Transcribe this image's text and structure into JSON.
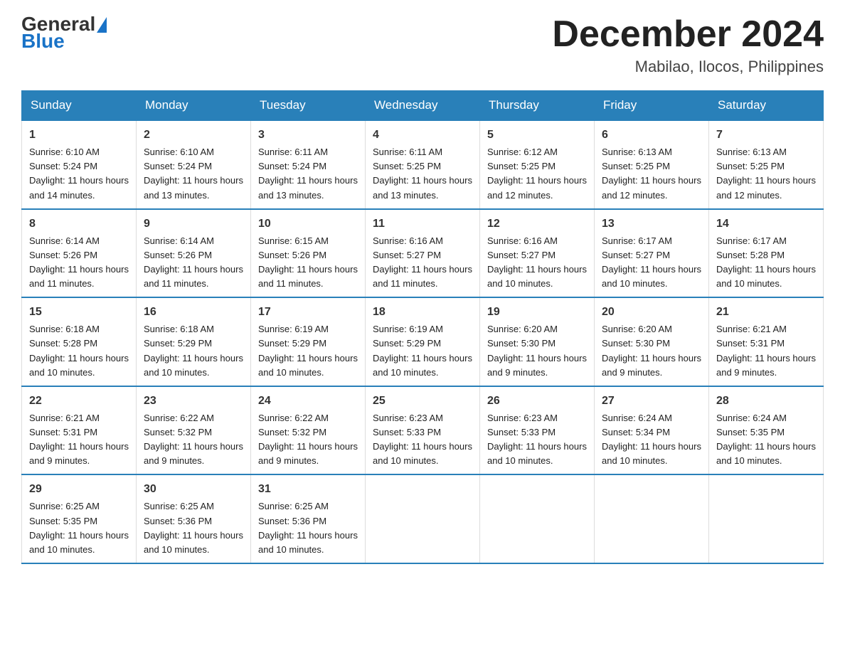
{
  "header": {
    "logo_general": "General",
    "logo_blue": "Blue",
    "month_title": "December 2024",
    "location": "Mabilao, Ilocos, Philippines"
  },
  "days_of_week": [
    "Sunday",
    "Monday",
    "Tuesday",
    "Wednesday",
    "Thursday",
    "Friday",
    "Saturday"
  ],
  "weeks": [
    [
      {
        "day": "1",
        "sunrise": "6:10 AM",
        "sunset": "5:24 PM",
        "daylight": "11 hours and 14 minutes."
      },
      {
        "day": "2",
        "sunrise": "6:10 AM",
        "sunset": "5:24 PM",
        "daylight": "11 hours and 13 minutes."
      },
      {
        "day": "3",
        "sunrise": "6:11 AM",
        "sunset": "5:24 PM",
        "daylight": "11 hours and 13 minutes."
      },
      {
        "day": "4",
        "sunrise": "6:11 AM",
        "sunset": "5:25 PM",
        "daylight": "11 hours and 13 minutes."
      },
      {
        "day": "5",
        "sunrise": "6:12 AM",
        "sunset": "5:25 PM",
        "daylight": "11 hours and 12 minutes."
      },
      {
        "day": "6",
        "sunrise": "6:13 AM",
        "sunset": "5:25 PM",
        "daylight": "11 hours and 12 minutes."
      },
      {
        "day": "7",
        "sunrise": "6:13 AM",
        "sunset": "5:25 PM",
        "daylight": "11 hours and 12 minutes."
      }
    ],
    [
      {
        "day": "8",
        "sunrise": "6:14 AM",
        "sunset": "5:26 PM",
        "daylight": "11 hours and 11 minutes."
      },
      {
        "day": "9",
        "sunrise": "6:14 AM",
        "sunset": "5:26 PM",
        "daylight": "11 hours and 11 minutes."
      },
      {
        "day": "10",
        "sunrise": "6:15 AM",
        "sunset": "5:26 PM",
        "daylight": "11 hours and 11 minutes."
      },
      {
        "day": "11",
        "sunrise": "6:16 AM",
        "sunset": "5:27 PM",
        "daylight": "11 hours and 11 minutes."
      },
      {
        "day": "12",
        "sunrise": "6:16 AM",
        "sunset": "5:27 PM",
        "daylight": "11 hours and 10 minutes."
      },
      {
        "day": "13",
        "sunrise": "6:17 AM",
        "sunset": "5:27 PM",
        "daylight": "11 hours and 10 minutes."
      },
      {
        "day": "14",
        "sunrise": "6:17 AM",
        "sunset": "5:28 PM",
        "daylight": "11 hours and 10 minutes."
      }
    ],
    [
      {
        "day": "15",
        "sunrise": "6:18 AM",
        "sunset": "5:28 PM",
        "daylight": "11 hours and 10 minutes."
      },
      {
        "day": "16",
        "sunrise": "6:18 AM",
        "sunset": "5:29 PM",
        "daylight": "11 hours and 10 minutes."
      },
      {
        "day": "17",
        "sunrise": "6:19 AM",
        "sunset": "5:29 PM",
        "daylight": "11 hours and 10 minutes."
      },
      {
        "day": "18",
        "sunrise": "6:19 AM",
        "sunset": "5:29 PM",
        "daylight": "11 hours and 10 minutes."
      },
      {
        "day": "19",
        "sunrise": "6:20 AM",
        "sunset": "5:30 PM",
        "daylight": "11 hours and 9 minutes."
      },
      {
        "day": "20",
        "sunrise": "6:20 AM",
        "sunset": "5:30 PM",
        "daylight": "11 hours and 9 minutes."
      },
      {
        "day": "21",
        "sunrise": "6:21 AM",
        "sunset": "5:31 PM",
        "daylight": "11 hours and 9 minutes."
      }
    ],
    [
      {
        "day": "22",
        "sunrise": "6:21 AM",
        "sunset": "5:31 PM",
        "daylight": "11 hours and 9 minutes."
      },
      {
        "day": "23",
        "sunrise": "6:22 AM",
        "sunset": "5:32 PM",
        "daylight": "11 hours and 9 minutes."
      },
      {
        "day": "24",
        "sunrise": "6:22 AM",
        "sunset": "5:32 PM",
        "daylight": "11 hours and 9 minutes."
      },
      {
        "day": "25",
        "sunrise": "6:23 AM",
        "sunset": "5:33 PM",
        "daylight": "11 hours and 10 minutes."
      },
      {
        "day": "26",
        "sunrise": "6:23 AM",
        "sunset": "5:33 PM",
        "daylight": "11 hours and 10 minutes."
      },
      {
        "day": "27",
        "sunrise": "6:24 AM",
        "sunset": "5:34 PM",
        "daylight": "11 hours and 10 minutes."
      },
      {
        "day": "28",
        "sunrise": "6:24 AM",
        "sunset": "5:35 PM",
        "daylight": "11 hours and 10 minutes."
      }
    ],
    [
      {
        "day": "29",
        "sunrise": "6:25 AM",
        "sunset": "5:35 PM",
        "daylight": "11 hours and 10 minutes."
      },
      {
        "day": "30",
        "sunrise": "6:25 AM",
        "sunset": "5:36 PM",
        "daylight": "11 hours and 10 minutes."
      },
      {
        "day": "31",
        "sunrise": "6:25 AM",
        "sunset": "5:36 PM",
        "daylight": "11 hours and 10 minutes."
      },
      null,
      null,
      null,
      null
    ]
  ],
  "labels": {
    "sunrise": "Sunrise:",
    "sunset": "Sunset:",
    "daylight": "Daylight:"
  }
}
